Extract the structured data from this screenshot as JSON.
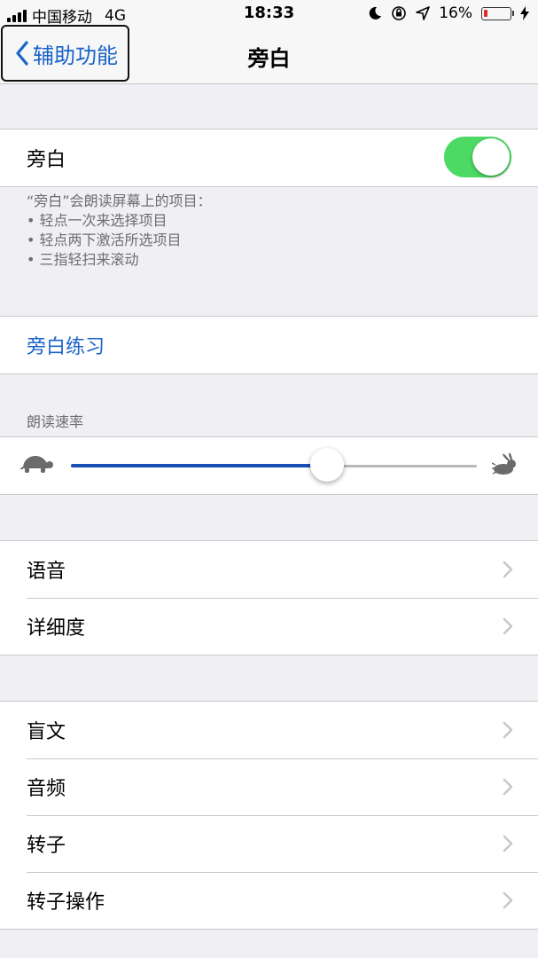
{
  "status_bar": {
    "carrier": "中国移动",
    "network": "4G",
    "time": "18:33",
    "battery_percent": "16%",
    "battery_level": 0.16,
    "battery_color": "#e02a2a"
  },
  "nav": {
    "back_label": "辅助功能",
    "title": "旁白"
  },
  "voiceover": {
    "label": "旁白",
    "enabled": true,
    "toggle_color": "#4cd964"
  },
  "footnote": {
    "intro": "“旁白”会朗读屏幕上的项目：",
    "items": [
      "• 轻点一次来选择项目",
      "• 轻点两下激活所选项目",
      "• 三指轻扫来滚动"
    ]
  },
  "practice": {
    "label": "旁白练习"
  },
  "speaking_rate": {
    "header": "朗读速率",
    "value": 0.63,
    "fill_color": "#1a4fb5",
    "slow_icon": "turtle-icon",
    "fast_icon": "rabbit-icon"
  },
  "group_voice": [
    {
      "label": "语音"
    },
    {
      "label": "详细度"
    }
  ],
  "group_more": [
    {
      "label": "盲文"
    },
    {
      "label": "音频"
    },
    {
      "label": "转子"
    },
    {
      "label": "转子操作"
    }
  ],
  "accent_color": "#1a63c9"
}
